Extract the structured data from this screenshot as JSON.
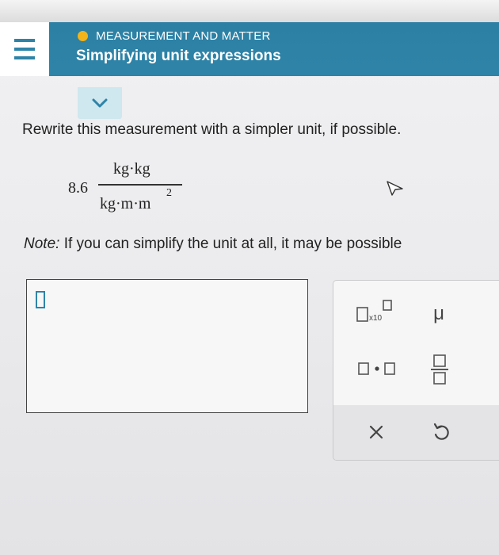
{
  "header": {
    "topic": "MEASUREMENT AND MATTER",
    "lesson_title": "Simplifying unit expressions",
    "topic_dot_color": "#f2b41a",
    "header_color": "#2e84a8",
    "menu_icon": "hamburger-icon"
  },
  "collapse": {
    "icon": "chevron-down-icon"
  },
  "problem": {
    "prompt": "Rewrite this measurement with a simpler unit, if possible.",
    "coefficient": "8.6",
    "numerator": "kg·kg",
    "denominator": "kg·m·m",
    "exponent": "2",
    "note_label": "Note:",
    "note_text": " If you can simplify the unit at all, it may be possible"
  },
  "answer": {
    "value": "",
    "caret_icon": "empty-box-cursor-icon"
  },
  "palette": {
    "sci_label": "x10",
    "mu_label": "μ",
    "keys": [
      "scientific-notation-icon",
      "mu-symbol",
      "multiply-dot-icon",
      "fraction-icon",
      "clear-x-icon",
      "undo-icon"
    ]
  }
}
